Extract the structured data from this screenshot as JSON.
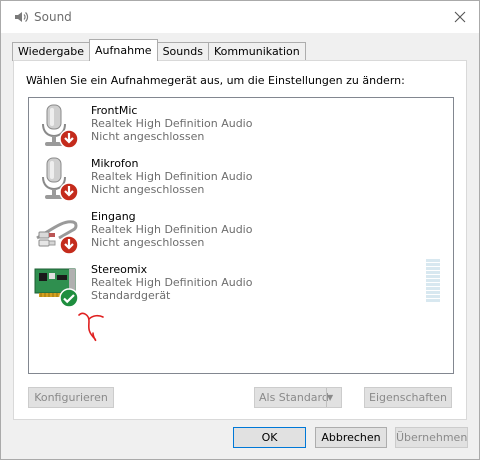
{
  "window": {
    "title": "Sound"
  },
  "tabs": [
    {
      "label": "Wiedergabe",
      "active": false
    },
    {
      "label": "Aufnahme",
      "active": true
    },
    {
      "label": "Sounds",
      "active": false
    },
    {
      "label": "Kommunikation",
      "active": false
    }
  ],
  "instruction": "Wählen Sie ein Aufnahmegerät aus, um die Einstellungen zu ändern:",
  "devices": [
    {
      "name": "FrontMic",
      "driver": "Realtek High Definition Audio",
      "status": "Nicht angeschlossen",
      "icon": "microphone-icon",
      "badge": "disconnected-badge-icon"
    },
    {
      "name": "Mikrofon",
      "driver": "Realtek High Definition Audio",
      "status": "Nicht angeschlossen",
      "icon": "microphone-icon",
      "badge": "disconnected-badge-icon"
    },
    {
      "name": "Eingang",
      "driver": "Realtek High Definition Audio",
      "status": "Nicht angeschlossen",
      "icon": "audio-cable-icon",
      "badge": "disconnected-badge-icon"
    },
    {
      "name": "Stereomix",
      "driver": "Realtek High Definition Audio",
      "status": "Standardgerät",
      "icon": "sound-card-icon",
      "badge": "default-check-badge-icon",
      "level": 0
    }
  ],
  "buttons": {
    "configure": "Konfigurieren",
    "set_default": "Als Standard",
    "properties": "Eigenschaften",
    "ok": "OK",
    "cancel": "Abbrechen",
    "apply": "Übernehmen"
  },
  "colors": {
    "disconnected_badge": "#c42b1c",
    "default_badge": "#1e8e3e",
    "annotation_stroke": "#e02020"
  }
}
